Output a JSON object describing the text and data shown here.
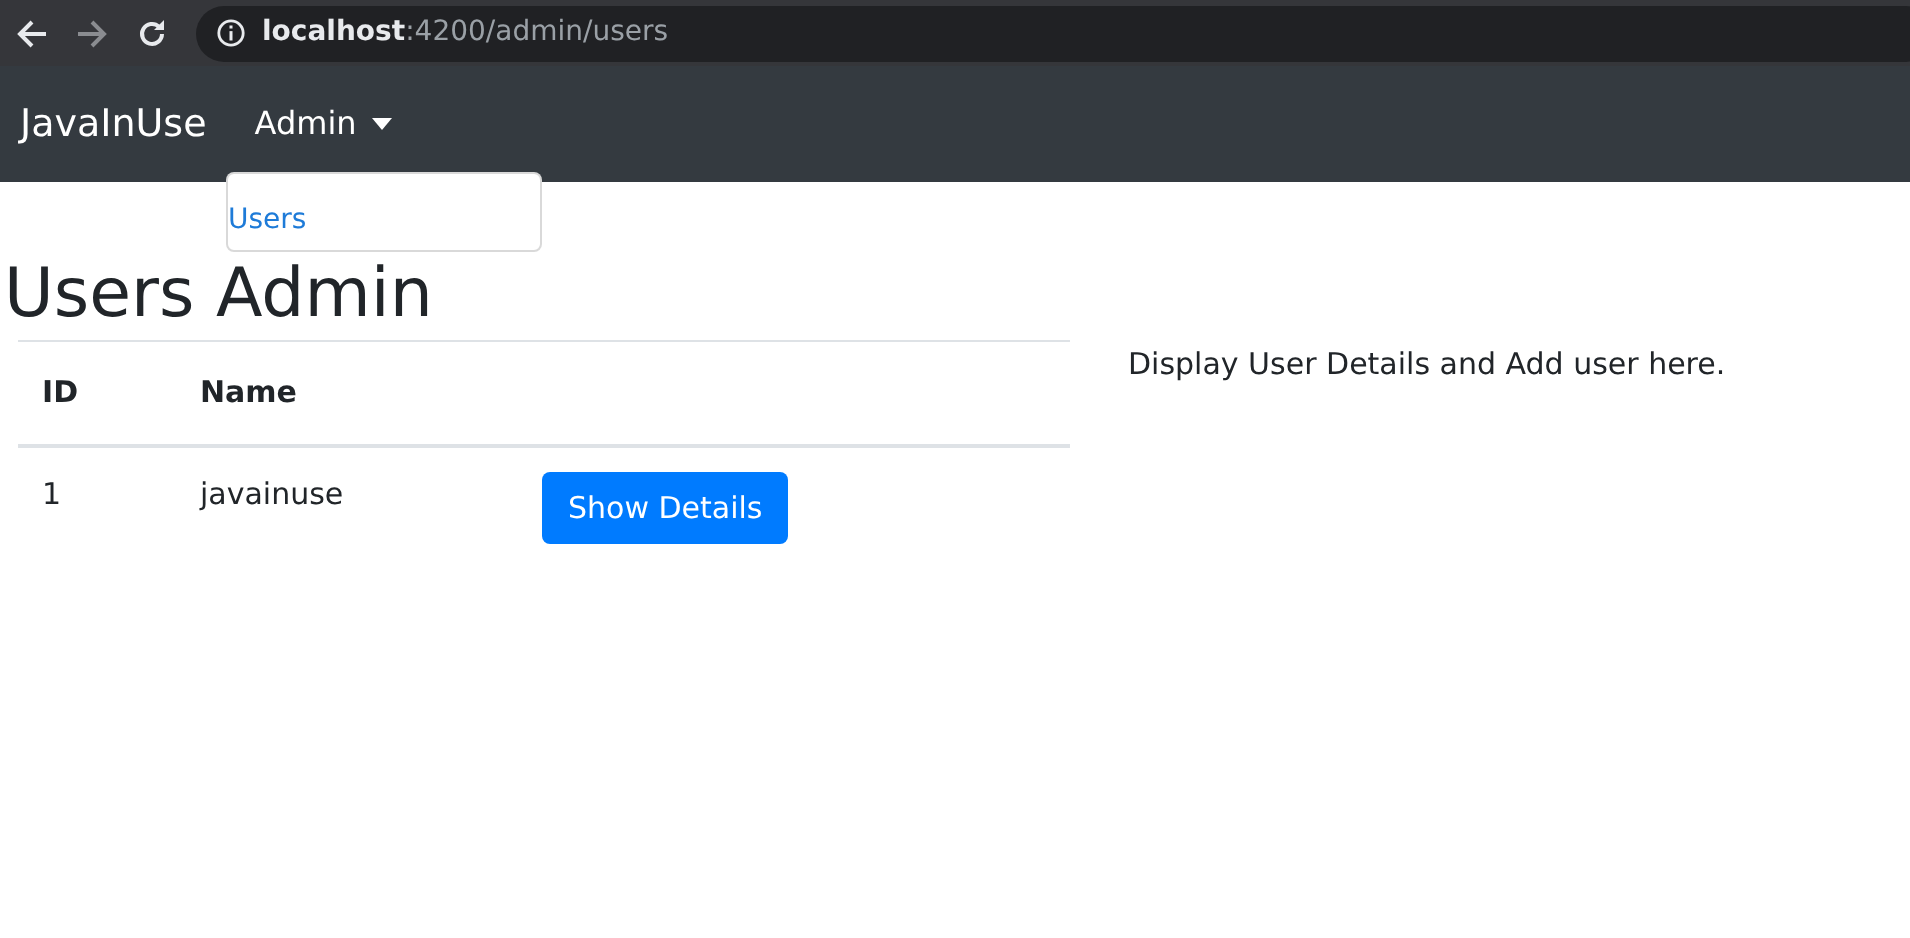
{
  "browser": {
    "address": "**localhost**:4200/admin/users"
  },
  "navbar": {
    "brand": "JavaInUse",
    "menu": {
      "label": "Admin",
      "expanded": true,
      "items": [
        {
          "label": "Users"
        }
      ]
    }
  },
  "heading": "Users Admin",
  "table": {
    "columns": [
      "ID",
      "Name"
    ],
    "rows": [
      {
        "cells": [
          "1",
          "javainuse"
        ],
        "button": "Show Details"
      }
    ]
  },
  "side_text": "Display User Details and Add user here."
}
